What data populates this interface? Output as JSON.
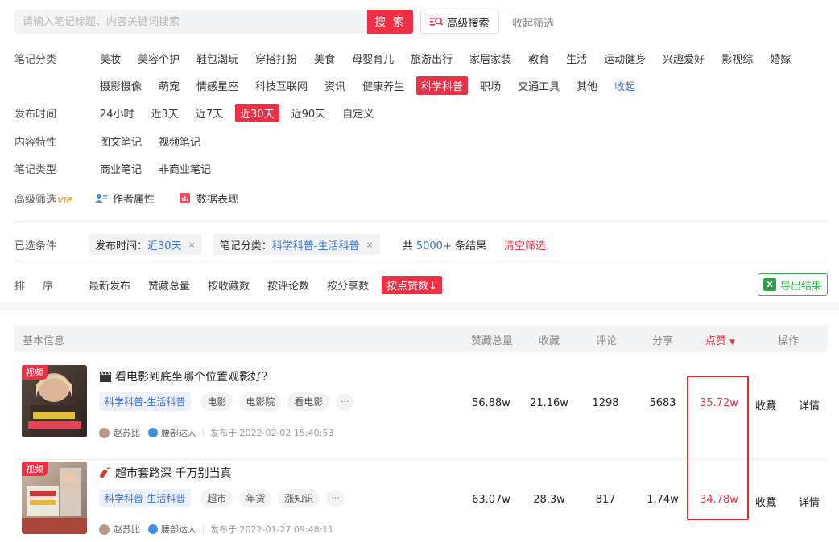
{
  "search": {
    "placeholder": "请输入笔记标题、内容关键词搜索",
    "value": "",
    "button_label": "搜 索",
    "advanced_label": "高级搜索",
    "collapse_label": "收起筛选"
  },
  "filters": {
    "category": {
      "label": "笔记分类",
      "row1": [
        "美妆",
        "美容个护",
        "鞋包潮玩",
        "穿搭打扮",
        "美食",
        "母婴育儿",
        "旅游出行",
        "家居家装",
        "教育",
        "生活",
        "运动健身",
        "兴趣爱好",
        "影视综",
        "婚嫁"
      ],
      "row2": [
        "摄影摄像",
        "萌宠",
        "情感星座",
        "科技互联网",
        "资讯",
        "健康养生",
        "科学科普",
        "职场",
        "交通工具",
        "其他"
      ],
      "active": "科学科普",
      "collapse": "收起"
    },
    "publish_time": {
      "label": "发布时间",
      "options": [
        "24小时",
        "近3天",
        "近7天",
        "近30天",
        "近90天",
        "自定义"
      ],
      "active": "近30天"
    },
    "content_type": {
      "label": "内容特性",
      "options": [
        "图文笔记",
        "视频笔记"
      ]
    },
    "note_type": {
      "label": "笔记类型",
      "options": [
        "商业笔记",
        "非商业笔记"
      ]
    },
    "advanced": {
      "label": "高级筛选",
      "vip": "VIP",
      "author_attr": "作者属性",
      "data_perf": "数据表现"
    }
  },
  "selected": {
    "label": "已选条件",
    "chips": [
      {
        "key": "发布时间：",
        "value": "近30天"
      },
      {
        "key": "笔记分类：",
        "value": "科学科普-生活科普"
      }
    ],
    "total_prefix": "共 ",
    "total_num": "5000+",
    "total_suffix": " 条结果",
    "clear": "清空筛选"
  },
  "sort": {
    "label": "排序",
    "options": [
      "最新发布",
      "赞藏总量",
      "按收藏数",
      "按评论数",
      "按分享数"
    ],
    "active": "按点赞数",
    "export": "导出结果"
  },
  "table": {
    "headers": {
      "basic": "基本信息",
      "total": "赞藏总量",
      "collect": "收藏",
      "comment": "评论",
      "share": "分享",
      "like": "点赞",
      "action": "操作"
    },
    "rows": [
      {
        "badge": "视频",
        "title": "看电影到底坐哪个位置观影好？",
        "category": "科学科普-生活科普",
        "keywords": [
          "电影",
          "电影院",
          "看电影"
        ],
        "more": "···",
        "author": "赵苏比",
        "level": "腰部达人",
        "published": "发布于  2022-02-02 15:40:53",
        "total": "56.88w",
        "collect": "21.16w",
        "comment": "1298",
        "share": "5683",
        "like": "35.72w",
        "action_collect": "收藏",
        "action_detail": "详情"
      },
      {
        "badge": "视频",
        "title": "超市套路深 千万别当真",
        "category": "科学科普-生活科普",
        "keywords": [
          "超市",
          "年货",
          "涨知识"
        ],
        "more": "···",
        "author": "赵苏比",
        "level": "腰部达人",
        "published": "发布于  2022-01-27 09:48:11",
        "total": "63.07w",
        "collect": "28.3w",
        "comment": "817",
        "share": "1.74w",
        "like": "34.78w",
        "action_collect": "收藏",
        "action_detail": "详情"
      }
    ]
  },
  "colors": {
    "accent": "#f02f44",
    "link": "#3a6ed8",
    "export_green": "#3fae55",
    "highlight_box": "#e22b2b"
  }
}
